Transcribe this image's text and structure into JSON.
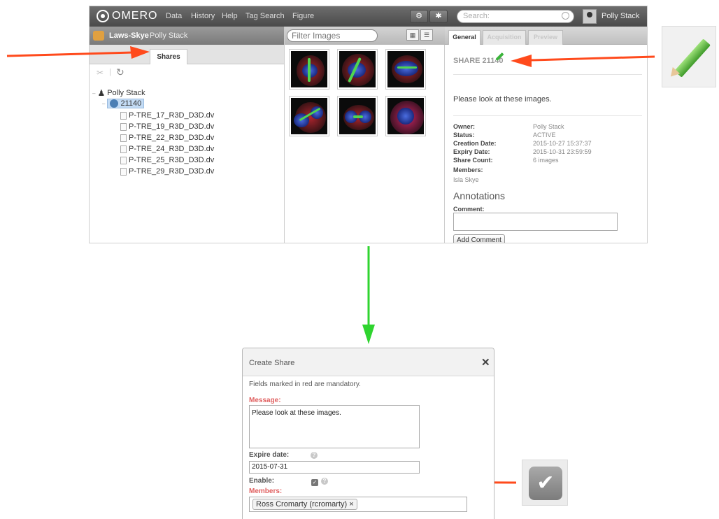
{
  "app": {
    "logo": "OMERO",
    "nav": [
      "Data",
      "History",
      "Help",
      "Tag Search",
      "Figure"
    ],
    "search_placeholder": "Search:",
    "user_name": "Polly Stack",
    "group_name": "Laws-Skye",
    "group_user": "Polly Stack",
    "left_tab": "Shares",
    "tree": {
      "owner": "Polly Stack",
      "share_id": "21140",
      "files": [
        "P-TRE_17_R3D_D3D.dv",
        "P-TRE_19_R3D_D3D.dv",
        "P-TRE_22_R3D_D3D.dv",
        "P-TRE_24_R3D_D3D.dv",
        "P-TRE_25_R3D_D3D.dv",
        "P-TRE_29_R3D_D3D.dv"
      ]
    },
    "center": {
      "filter_placeholder": "Filter Images"
    },
    "right": {
      "tabs": [
        "General",
        "Acquisition",
        "Preview"
      ],
      "share_title": "SHARE 21140",
      "message": "Please look at these images.",
      "fields": [
        {
          "label": "Owner:",
          "value": "Polly Stack"
        },
        {
          "label": "Status:",
          "value": "ACTIVE"
        },
        {
          "label": "Creation Date:",
          "value": "2015-10-27 15:37:37"
        },
        {
          "label": "Expiry Date:",
          "value": "2015-10-31 23:59:59"
        },
        {
          "label": "Share Count:",
          "value": "6 images"
        },
        {
          "label": "Members:",
          "value": ""
        }
      ],
      "members": "Isla Skye",
      "annotations_title": "Annotations",
      "comment_label": "Comment:",
      "add_comment_label": "Add Comment"
    }
  },
  "dialog": {
    "title": "Create Share",
    "close": "✕",
    "mandatory_note": "Fields marked in red are mandatory.",
    "message_label": "Message:",
    "message_value": "Please look at these images.",
    "expire_label": "Expire date:",
    "expire_value": "2015-07-31",
    "enable_label": "Enable:",
    "members_label": "Members:",
    "member_tag": "Ross Cromarty (rcromarty) ×",
    "help": "?"
  },
  "colors": {
    "arrow_red": "#ff4a1c",
    "arrow_green": "#2fd42f",
    "mandatory": "#e06060",
    "toolbar_dark": "#4a4a4a"
  }
}
